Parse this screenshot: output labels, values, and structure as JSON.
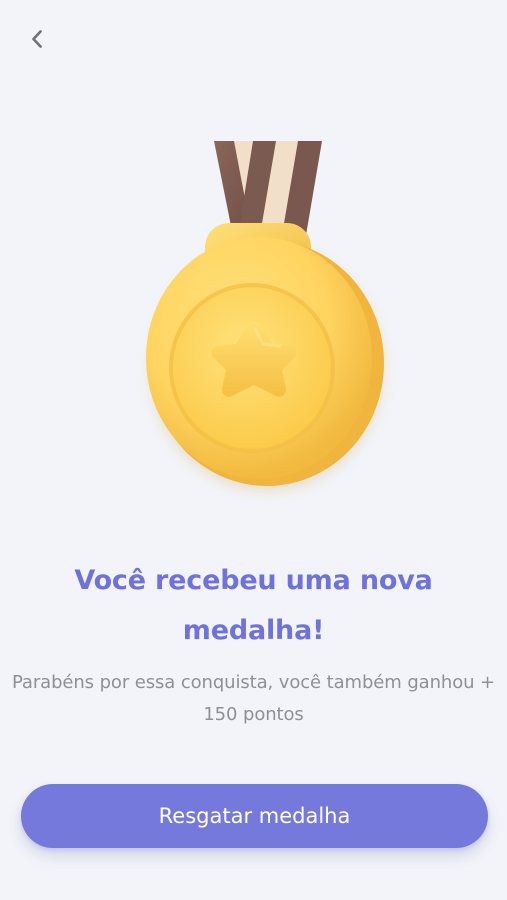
{
  "header": {
    "back_icon": "chevron-left-icon"
  },
  "content": {
    "title": "Você recebeu uma nova medalha!",
    "subtitle": "Parabéns por essa conquista, você também ganhou + 150 pontos",
    "medal_icon": "gold-star-medal-icon"
  },
  "actions": {
    "cta_label": "Resgatar medalha"
  },
  "colors": {
    "background": "#f2f4f9",
    "accent": "#7579dc",
    "title": "#6f72dc",
    "subtitle": "#8d9097",
    "medal_gold": "#ffd15b",
    "medal_shadow": "#efb33d",
    "ribbon_brown": "#7c5a50",
    "ribbon_light": "#f2dfc9"
  }
}
